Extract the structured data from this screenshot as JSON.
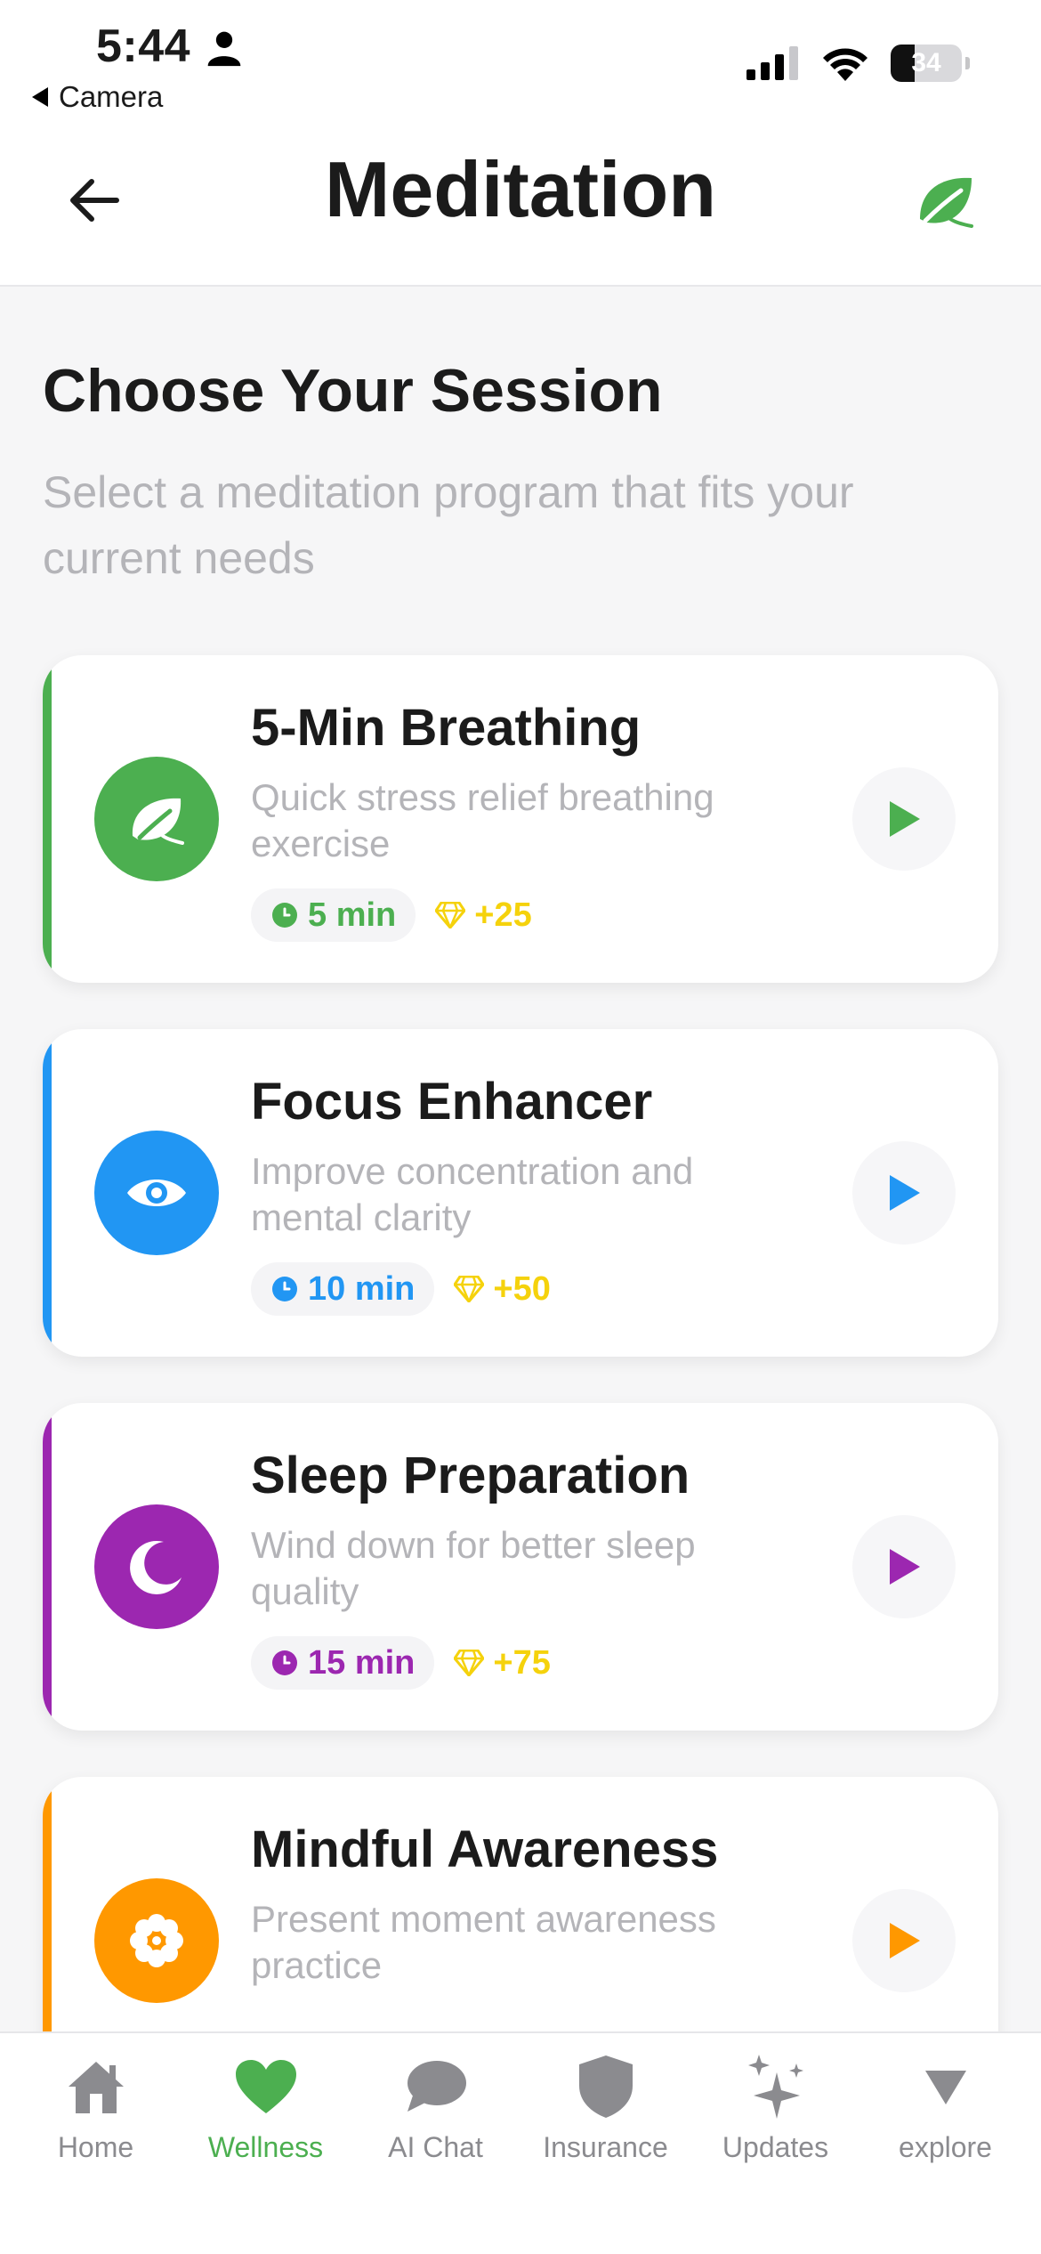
{
  "status_bar": {
    "time": "5:44",
    "back_app": "Camera",
    "battery": "34"
  },
  "header": {
    "title": "Meditation"
  },
  "intro": {
    "title": "Choose Your Session",
    "subtitle": "Select a meditation program that fits your current needs"
  },
  "sessions": [
    {
      "title": "5-Min Breathing",
      "description": "Quick stress relief breathing exercise",
      "duration": "5 min",
      "points": "+25",
      "color": "#4caf50",
      "icon": "leaf-icon"
    },
    {
      "title": "Focus Enhancer",
      "description": "Improve concentration and mental clarity",
      "duration": "10 min",
      "points": "+50",
      "color": "#2196f3",
      "icon": "eye-icon"
    },
    {
      "title": "Sleep Preparation",
      "description": "Wind down for better sleep quality",
      "duration": "15 min",
      "points": "+75",
      "color": "#9c27b0",
      "icon": "moon-icon"
    },
    {
      "title": "Mindful Awareness",
      "description": "Present moment awareness practice",
      "duration": "",
      "points": "",
      "color": "#ff9800",
      "icon": "flower-icon"
    }
  ],
  "colors": {
    "accent_green": "#4caf50",
    "points_yellow": "#f5d20c",
    "muted_text": "#b4b4b8"
  },
  "tabs": [
    {
      "label": "Home",
      "icon": "home-icon",
      "active": false
    },
    {
      "label": "Wellness",
      "icon": "heart-icon",
      "active": true
    },
    {
      "label": "AI Chat",
      "icon": "chat-bubble-icon",
      "active": false
    },
    {
      "label": "Insurance",
      "icon": "shield-icon",
      "active": false
    },
    {
      "label": "Updates",
      "icon": "sparkles-icon",
      "active": false
    },
    {
      "label": "explore",
      "icon": "triangle-down-icon",
      "active": false
    }
  ]
}
